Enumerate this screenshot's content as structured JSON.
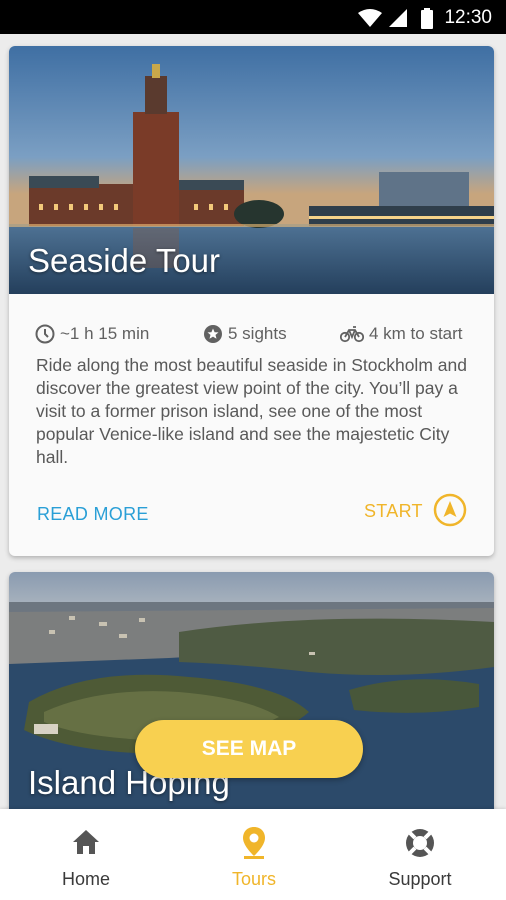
{
  "status_bar": {
    "time": "12:30"
  },
  "tours": [
    {
      "title": "Seaside Tour",
      "duration": "~1 h 15 min",
      "sights": "5 sights",
      "distance": "4 km to start",
      "description": "Ride along the most beautiful seaside in Stockholm and discover the greatest view point of the city. You’ll pay a visit to a former prison island, see one of the most popular Venice-like island and see the majestetic City hall.",
      "read_more_label": "READ MORE",
      "start_label": "START"
    },
    {
      "title": "Island Hoping"
    }
  ],
  "see_map_label": "SEE MAP",
  "bottom_nav": {
    "items": [
      {
        "label": "Home",
        "icon": "home-icon"
      },
      {
        "label": "Tours",
        "icon": "location-pin-icon",
        "active": true
      },
      {
        "label": "Support",
        "icon": "lifebuoy-icon"
      }
    ]
  },
  "colors": {
    "accent": "#f0b52a",
    "link": "#2a9fd6",
    "fab": "#f8d050",
    "text": "#595959"
  }
}
